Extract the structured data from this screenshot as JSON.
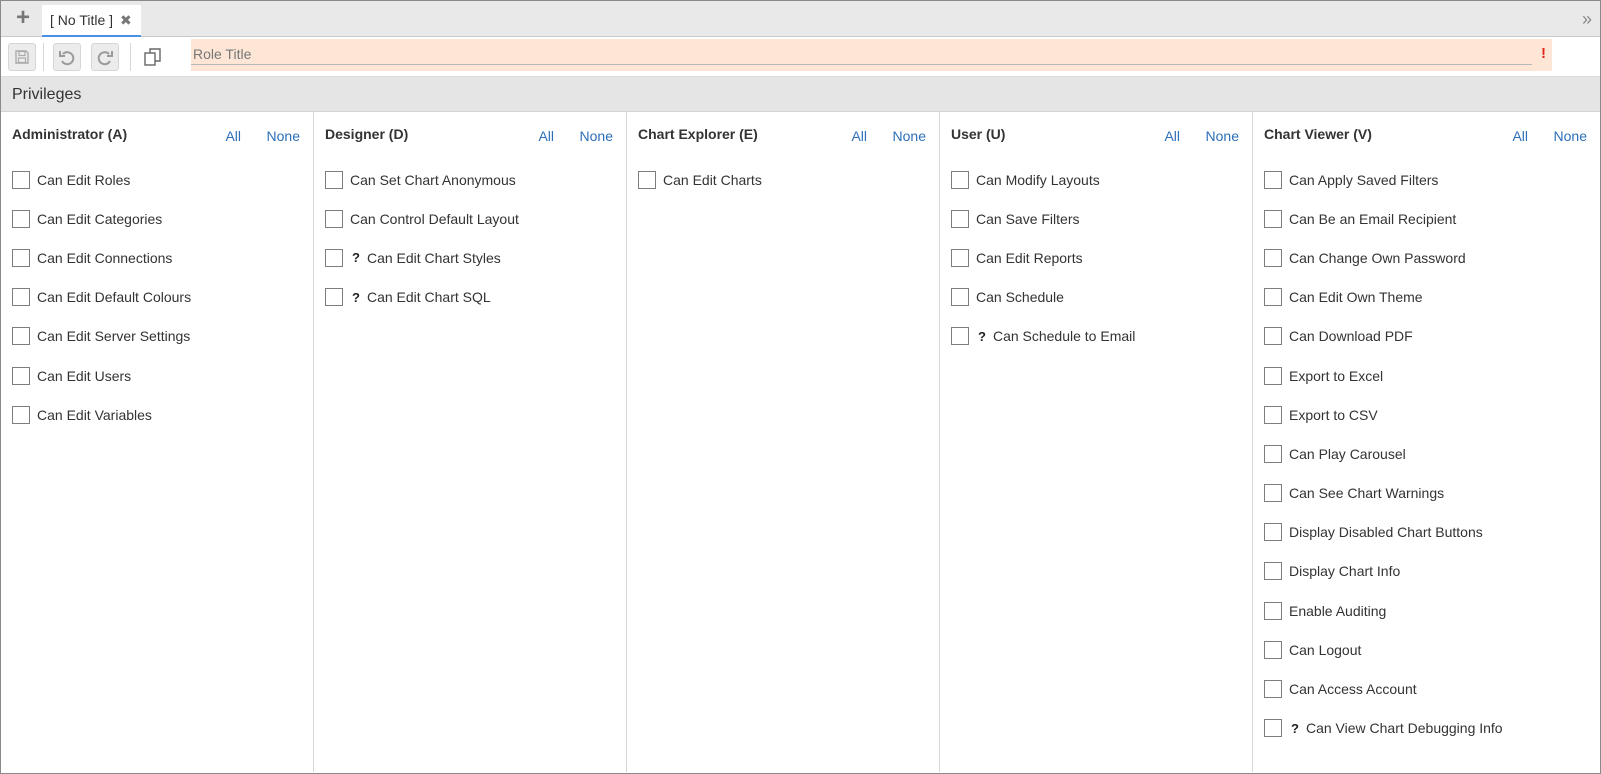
{
  "tabs": {
    "add_symbol": "+",
    "active": {
      "label": "[ No Title ]",
      "close": "✖"
    },
    "overflow_symbol": "»"
  },
  "toolbar": {
    "icons": [
      "save-icon",
      "undo-icon",
      "redo-icon",
      "copy-icon"
    ]
  },
  "title_field": {
    "placeholder": "Role Title",
    "value": "",
    "required_mark": "!"
  },
  "section": {
    "title": "Privileges"
  },
  "colors": {
    "link": "#2d6fb8",
    "required": "#e0281e",
    "title_bg": "#fde6d6"
  },
  "columns": [
    {
      "title": "Administrator (A)",
      "all": "All",
      "none": "None",
      "items": [
        {
          "label": "Can Edit Roles",
          "help": false
        },
        {
          "label": "Can Edit Categories",
          "help": false
        },
        {
          "label": "Can Edit Connections",
          "help": false
        },
        {
          "label": "Can Edit Default Colours",
          "help": false
        },
        {
          "label": "Can Edit Server Settings",
          "help": false
        },
        {
          "label": "Can Edit Users",
          "help": false
        },
        {
          "label": "Can Edit Variables",
          "help": false
        }
      ]
    },
    {
      "title": "Designer (D)",
      "all": "All",
      "none": "None",
      "items": [
        {
          "label": "Can Set Chart Anonymous",
          "help": false
        },
        {
          "label": "Can Control Default Layout",
          "help": false
        },
        {
          "label": "Can Edit Chart Styles",
          "help": true
        },
        {
          "label": "Can Edit Chart SQL",
          "help": true
        }
      ]
    },
    {
      "title": "Chart Explorer (E)",
      "all": "All",
      "none": "None",
      "items": [
        {
          "label": "Can Edit Charts",
          "help": false
        }
      ]
    },
    {
      "title": "User (U)",
      "all": "All",
      "none": "None",
      "items": [
        {
          "label": "Can Modify Layouts",
          "help": false
        },
        {
          "label": "Can Save Filters",
          "help": false
        },
        {
          "label": "Can Edit Reports",
          "help": false
        },
        {
          "label": "Can Schedule",
          "help": false
        },
        {
          "label": "Can Schedule to Email",
          "help": true
        }
      ]
    },
    {
      "title": "Chart Viewer (V)",
      "all": "All",
      "none": "None",
      "items": [
        {
          "label": "Can Apply Saved Filters",
          "help": false
        },
        {
          "label": "Can Be an Email Recipient",
          "help": false
        },
        {
          "label": "Can Change Own Password",
          "help": false
        },
        {
          "label": "Can Edit Own Theme",
          "help": false
        },
        {
          "label": "Can Download PDF",
          "help": false
        },
        {
          "label": "Export to Excel",
          "help": false
        },
        {
          "label": "Export to CSV",
          "help": false
        },
        {
          "label": "Can Play Carousel",
          "help": false
        },
        {
          "label": "Can See Chart Warnings",
          "help": false
        },
        {
          "label": "Display Disabled Chart Buttons",
          "help": false
        },
        {
          "label": "Display Chart Info",
          "help": false
        },
        {
          "label": "Enable Auditing",
          "help": false
        },
        {
          "label": "Can Logout",
          "help": false
        },
        {
          "label": "Can Access Account",
          "help": false
        },
        {
          "label": "Can View Chart Debugging Info",
          "help": true
        }
      ]
    }
  ],
  "help_symbol": "?"
}
